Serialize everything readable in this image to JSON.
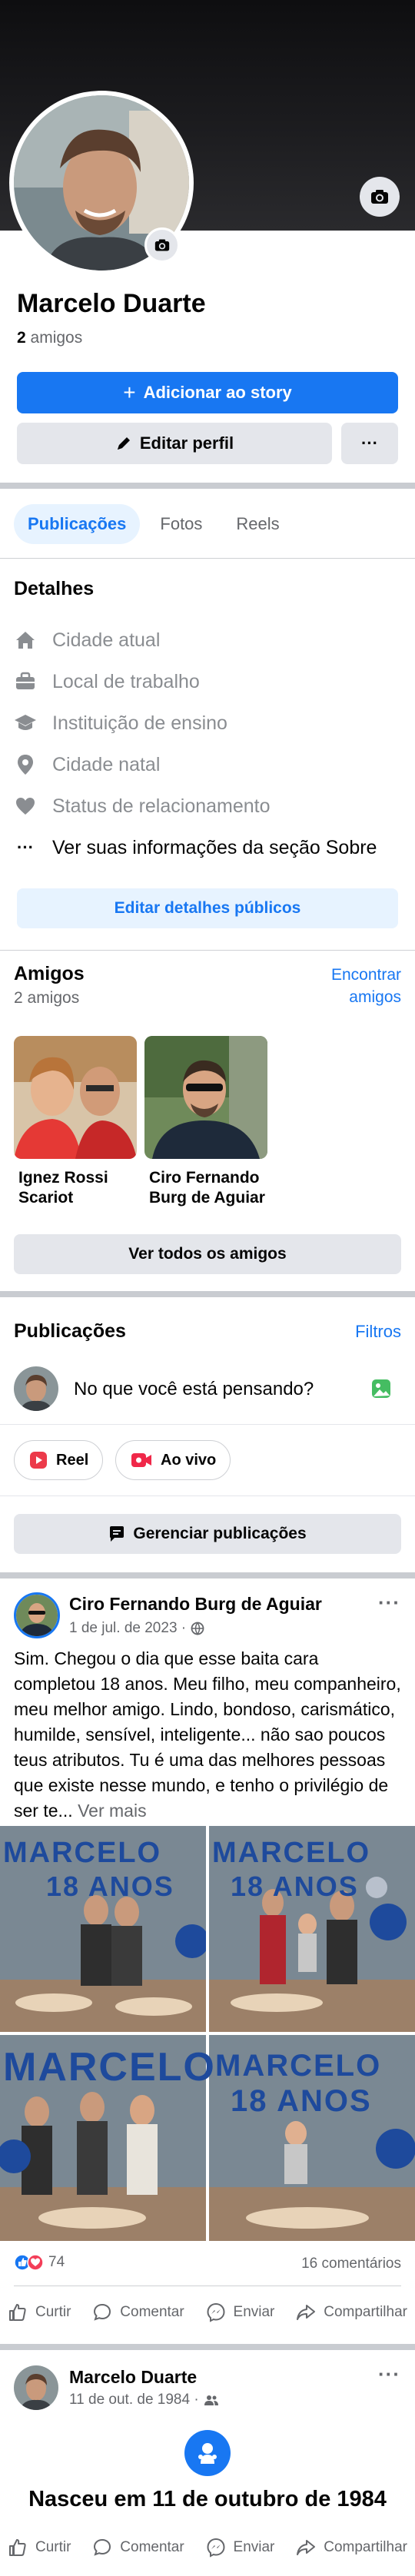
{
  "profile": {
    "name": "Marcelo Duarte",
    "friends_number": "2",
    "friends_word": "amigos",
    "add_story_label": "Adicionar ao story",
    "edit_profile_label": "Editar perfil",
    "more_label": "···"
  },
  "tabs": [
    {
      "label": "Publicações",
      "active": true
    },
    {
      "label": "Fotos",
      "active": false
    },
    {
      "label": "Reels",
      "active": false
    }
  ],
  "details": {
    "title": "Detalhes",
    "items": [
      {
        "icon": "house-icon",
        "label": "Cidade atual"
      },
      {
        "icon": "briefcase-icon",
        "label": "Local de trabalho"
      },
      {
        "icon": "graduation-cap-icon",
        "label": "Instituição de ensino"
      },
      {
        "icon": "location-pin-icon",
        "label": "Cidade natal"
      },
      {
        "icon": "heart-icon",
        "label": "Status de relacionamento"
      },
      {
        "icon": "more-dots-icon",
        "label": "Ver suas informações da seção Sobre"
      }
    ],
    "edit_button": "Editar detalhes públicos"
  },
  "friends": {
    "title": "Amigos",
    "count": "2 amigos",
    "find_link_line1": "Encontrar",
    "find_link_line2": "amigos",
    "list": [
      {
        "name_line1": "Ignez Rossi",
        "name_line2": "Scariot"
      },
      {
        "name_line1": "Ciro Fernando",
        "name_line2": "Burg de Aguiar"
      }
    ],
    "see_all": "Ver todos os amigos"
  },
  "publications": {
    "title": "Publicações",
    "filters": "Filtros",
    "composer_placeholder": "No que você está pensando?",
    "reel_chip": "Reel",
    "live_chip": "Ao vivo",
    "manage_button": "Gerenciar publicações"
  },
  "post1": {
    "author": "Ciro Fernando Burg de Aguiar",
    "date": "1 de jul. de 2023 ·",
    "text": "Sim. Chegou o dia que esse baita cara completou 18 anos. Meu filho, meu companheiro, meu melhor amigo. Lindo, bondoso, carismático, humilde, sensível, inteligente... não sao poucos teus atributos. Tu é uma das melhores pessoas que existe nesse mundo, e tenho o privilégio de ser te...",
    "see_more": "Ver mais",
    "banner_text_1": "MARCELO",
    "banner_text_2": "18 ANOS",
    "reactions_count": "74",
    "comments_count": "16 comentários",
    "actions": [
      "Curtir",
      "Comentar",
      "Enviar",
      "Compartilhar"
    ]
  },
  "post2": {
    "author": "Marcelo Duarte",
    "date": "11 de out. de 1984 ·",
    "life_event": "Nasceu em 11 de outubro de 1984",
    "actions": [
      "Curtir",
      "Comentar",
      "Enviar",
      "Compartilhar"
    ]
  },
  "colors": {
    "accent": "#1877f2",
    "light_accent": "#e7f3ff",
    "gray_button": "#e4e6eb",
    "secondary_text": "#65676b"
  }
}
